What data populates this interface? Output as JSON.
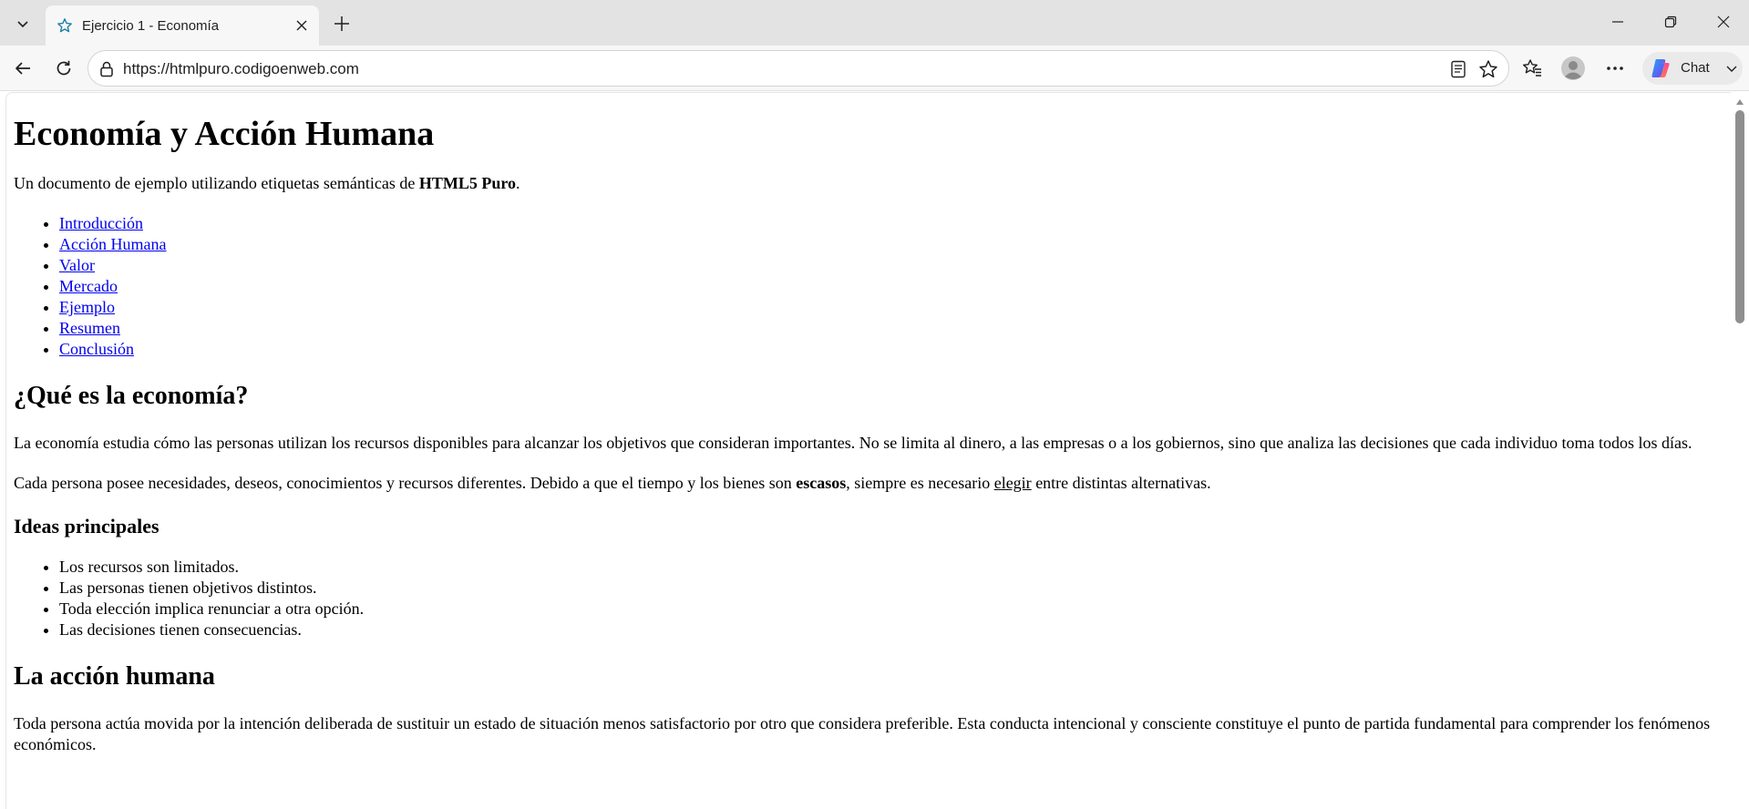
{
  "browser": {
    "tab": {
      "title": "Ejercicio 1 - Economía"
    },
    "address": {
      "url": "https://htmlpuro.codigoenweb.com"
    },
    "chat": {
      "label": "Chat"
    },
    "icons": {
      "tab_list": "chevron-down-icon",
      "favicon": "star-outline-icon",
      "close": "close-icon",
      "new_tab": "plus-icon",
      "minimize": "minimize-icon",
      "restore": "restore-icon",
      "window_close": "close-icon",
      "back": "back-arrow-icon",
      "refresh": "refresh-icon",
      "site_info": "lock-icon",
      "reader": "reader-view-icon",
      "favorite": "star-icon",
      "favorites": "favorites-icon",
      "profile": "avatar-icon",
      "more": "more-icon"
    }
  },
  "page": {
    "title": "Economía y Acción Humana",
    "intro": {
      "prefix": "Un documento de ejemplo utilizando etiquetas semánticas de ",
      "strong": "HTML5 Puro",
      "suffix": "."
    },
    "toc": [
      "Introducción",
      "Acción Humana",
      "Valor",
      "Mercado",
      "Ejemplo",
      "Resumen",
      "Conclusión"
    ],
    "section1": {
      "heading": "¿Qué es la economía?",
      "p1": "La economía estudia cómo las personas utilizan los recursos disponibles para alcanzar los objetivos que consideran importantes. No se limita al dinero, a las empresas o a los gobiernos, sino que analiza las decisiones que cada individuo toma todos los días.",
      "p2": {
        "a": "Cada persona posee necesidades, deseos, conocimientos y recursos diferentes. Debido a que el tiempo y los bienes son ",
        "strong": "escasos",
        "b": ", siempre es necesario ",
        "u": "elegir",
        "c": " entre distintas alternativas."
      },
      "subheading": "Ideas principales",
      "ideas": [
        "Los recursos son limitados.",
        "Las personas tienen objetivos distintos.",
        "Toda elección implica renunciar a otra opción.",
        "Las decisiones tienen consecuencias."
      ]
    },
    "section2": {
      "heading": "La acción humana",
      "p1": "Toda persona actúa movida por la intención deliberada de sustituir un estado de situación menos satisfactorio por otro que considera preferible. Esta conducta intencional y consciente constituye el punto de partida fundamental para comprender los fenómenos económicos."
    }
  }
}
